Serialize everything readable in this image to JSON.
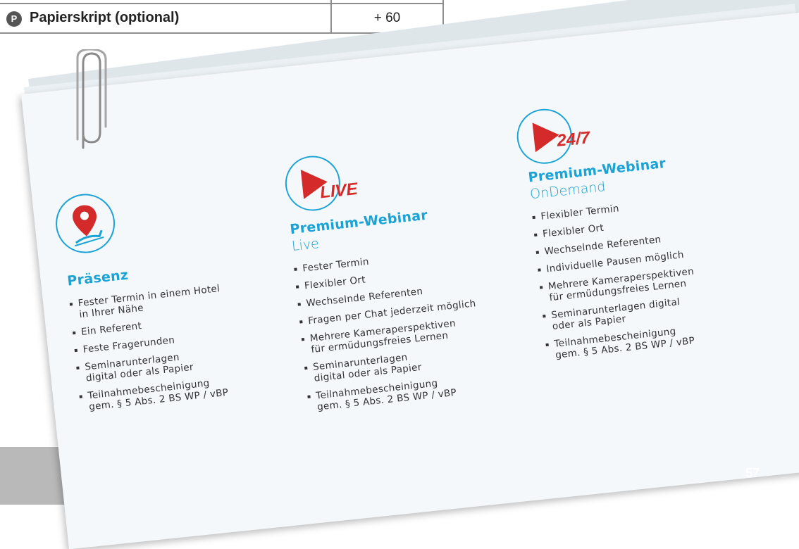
{
  "price_table": {
    "badge": "P",
    "label": "Papierskript (optional)",
    "value": "+ 60"
  },
  "columns": [
    {
      "title": "Präsenz",
      "items": [
        [
          "Fester Termin in einem Hotel",
          "in Ihrer Nähe"
        ],
        [
          "Ein Referent"
        ],
        [
          "Feste Fragerunden"
        ],
        [
          "Seminarunterlagen",
          "digital oder als Papier"
        ],
        [
          "Teilnahmebescheinigung",
          "gem. § 5 Abs. 2 BS WP / vBP"
        ]
      ]
    },
    {
      "tag": "LIVE",
      "title": "Premium-Webinar",
      "subtitle": "Live",
      "items": [
        [
          "Fester Termin"
        ],
        [
          "Flexibler Ort"
        ],
        [
          "Wechselnde Referenten"
        ],
        [
          "Fragen per Chat jederzeit möglich"
        ],
        [
          "Mehrere Kameraperspektiven",
          "für ermüdungsfreies Lernen"
        ],
        [
          "Seminarunterlagen",
          "digital oder als Papier"
        ],
        [
          "Teilnahmebescheinigung",
          "gem. § 5 Abs. 2 BS WP / vBP"
        ]
      ]
    },
    {
      "tag": "24/7",
      "title": "Premium-Webinar",
      "subtitle": "OnDemand",
      "items": [
        [
          "Flexibler Termin"
        ],
        [
          "Flexibler Ort"
        ],
        [
          "Wechselnde Referenten"
        ],
        [
          "Individuelle Pausen möglich"
        ],
        [
          "Mehrere Kameraperspektiven",
          "für ermüdungsfreies Lernen"
        ],
        [
          "Seminarunterlagen digital",
          "oder als Papier"
        ],
        [
          "Teilnahmebescheinigung",
          "gem. § 5 Abs. 2 BS WP / vBP"
        ]
      ]
    }
  ],
  "page_number": "57",
  "colors": {
    "accent": "#1ba3d6",
    "play": "#d52a2a",
    "paper": "#f4f8fa",
    "grey_block": "#b9b9b9"
  },
  "icons": [
    "location-pin-icon",
    "play-icon",
    "paperclip-icon"
  ]
}
